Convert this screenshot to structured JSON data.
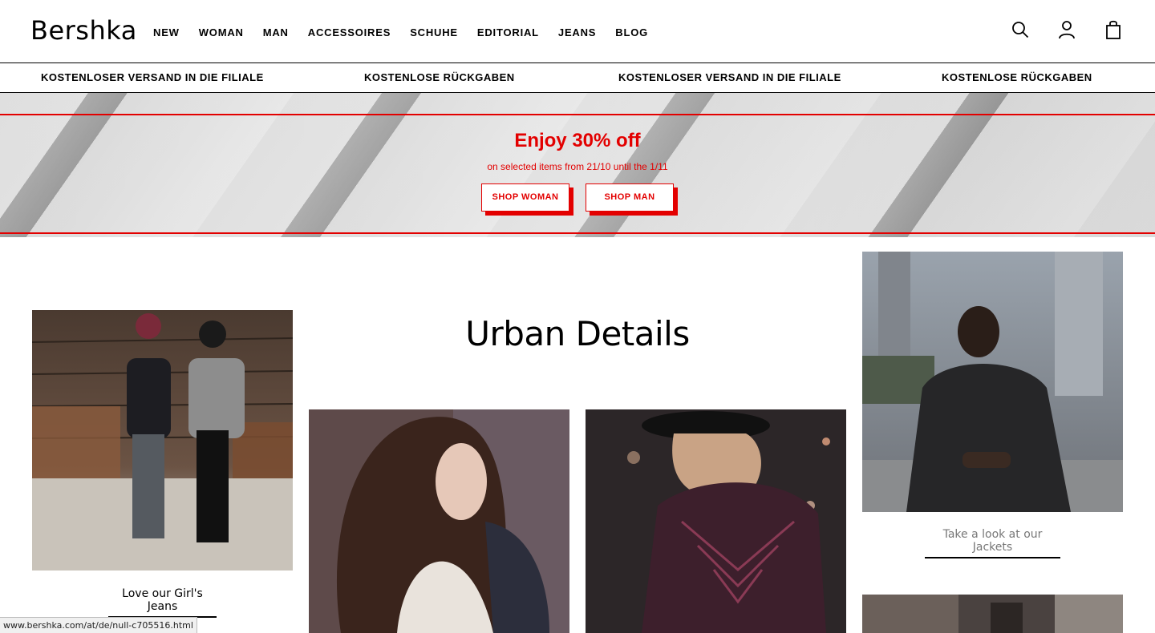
{
  "header": {
    "logo": "Bershka",
    "nav": [
      "NEW",
      "WOMAN",
      "MAN",
      "ACCESSOIRES",
      "SCHUHE",
      "EDITORIAL",
      "JEANS",
      "BLOG"
    ]
  },
  "shipping_bar": [
    "KOSTENLOSER VERSAND IN DIE FILIALE",
    "KOSTENLOSE RÜCKGABEN",
    "KOSTENLOSER VERSAND IN DIE FILIALE",
    "KOSTENLOSE RÜCKGABEN"
  ],
  "promo": {
    "title": "Enjoy 30% off",
    "subtitle": "on selected items from 21/10 until the 1/11",
    "button_woman": "SHOP WOMAN",
    "button_man": "SHOP MAN"
  },
  "main": {
    "heading": "Urban Details",
    "caption_girls_jeans": "Love our Girl's Jeans",
    "caption_jackets": "Take a look at our Jackets"
  },
  "status_url": "www.bershka.com/at/de/null-c705516.html",
  "colors": {
    "accent_red": "#e30000",
    "text": "#000000"
  }
}
